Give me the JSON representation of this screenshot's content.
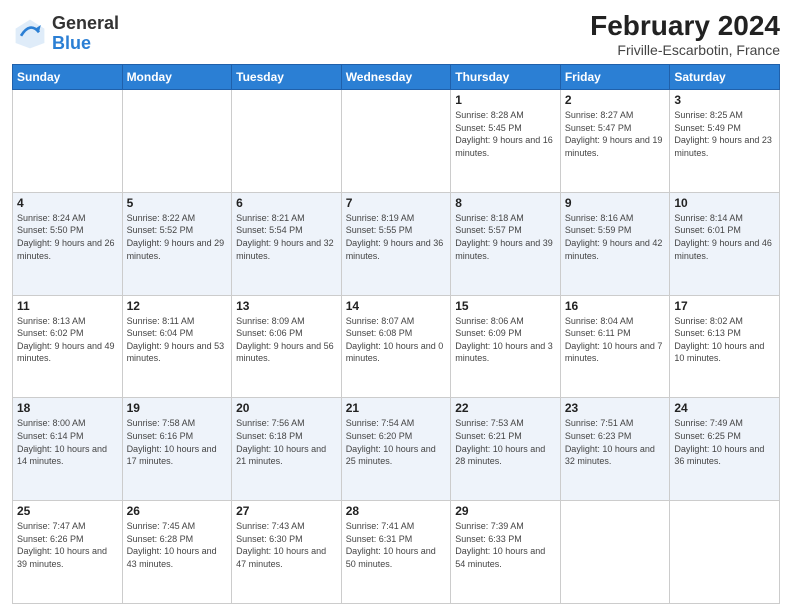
{
  "logo": {
    "general": "General",
    "blue": "Blue"
  },
  "title": "February 2024",
  "subtitle": "Friville-Escarbotin, France",
  "weekdays": [
    "Sunday",
    "Monday",
    "Tuesday",
    "Wednesday",
    "Thursday",
    "Friday",
    "Saturday"
  ],
  "weeks": [
    [
      {
        "day": "",
        "info": ""
      },
      {
        "day": "",
        "info": ""
      },
      {
        "day": "",
        "info": ""
      },
      {
        "day": "",
        "info": ""
      },
      {
        "day": "1",
        "info": "Sunrise: 8:28 AM\nSunset: 5:45 PM\nDaylight: 9 hours and 16 minutes."
      },
      {
        "day": "2",
        "info": "Sunrise: 8:27 AM\nSunset: 5:47 PM\nDaylight: 9 hours and 19 minutes."
      },
      {
        "day": "3",
        "info": "Sunrise: 8:25 AM\nSunset: 5:49 PM\nDaylight: 9 hours and 23 minutes."
      }
    ],
    [
      {
        "day": "4",
        "info": "Sunrise: 8:24 AM\nSunset: 5:50 PM\nDaylight: 9 hours and 26 minutes."
      },
      {
        "day": "5",
        "info": "Sunrise: 8:22 AM\nSunset: 5:52 PM\nDaylight: 9 hours and 29 minutes."
      },
      {
        "day": "6",
        "info": "Sunrise: 8:21 AM\nSunset: 5:54 PM\nDaylight: 9 hours and 32 minutes."
      },
      {
        "day": "7",
        "info": "Sunrise: 8:19 AM\nSunset: 5:55 PM\nDaylight: 9 hours and 36 minutes."
      },
      {
        "day": "8",
        "info": "Sunrise: 8:18 AM\nSunset: 5:57 PM\nDaylight: 9 hours and 39 minutes."
      },
      {
        "day": "9",
        "info": "Sunrise: 8:16 AM\nSunset: 5:59 PM\nDaylight: 9 hours and 42 minutes."
      },
      {
        "day": "10",
        "info": "Sunrise: 8:14 AM\nSunset: 6:01 PM\nDaylight: 9 hours and 46 minutes."
      }
    ],
    [
      {
        "day": "11",
        "info": "Sunrise: 8:13 AM\nSunset: 6:02 PM\nDaylight: 9 hours and 49 minutes."
      },
      {
        "day": "12",
        "info": "Sunrise: 8:11 AM\nSunset: 6:04 PM\nDaylight: 9 hours and 53 minutes."
      },
      {
        "day": "13",
        "info": "Sunrise: 8:09 AM\nSunset: 6:06 PM\nDaylight: 9 hours and 56 minutes."
      },
      {
        "day": "14",
        "info": "Sunrise: 8:07 AM\nSunset: 6:08 PM\nDaylight: 10 hours and 0 minutes."
      },
      {
        "day": "15",
        "info": "Sunrise: 8:06 AM\nSunset: 6:09 PM\nDaylight: 10 hours and 3 minutes."
      },
      {
        "day": "16",
        "info": "Sunrise: 8:04 AM\nSunset: 6:11 PM\nDaylight: 10 hours and 7 minutes."
      },
      {
        "day": "17",
        "info": "Sunrise: 8:02 AM\nSunset: 6:13 PM\nDaylight: 10 hours and 10 minutes."
      }
    ],
    [
      {
        "day": "18",
        "info": "Sunrise: 8:00 AM\nSunset: 6:14 PM\nDaylight: 10 hours and 14 minutes."
      },
      {
        "day": "19",
        "info": "Sunrise: 7:58 AM\nSunset: 6:16 PM\nDaylight: 10 hours and 17 minutes."
      },
      {
        "day": "20",
        "info": "Sunrise: 7:56 AM\nSunset: 6:18 PM\nDaylight: 10 hours and 21 minutes."
      },
      {
        "day": "21",
        "info": "Sunrise: 7:54 AM\nSunset: 6:20 PM\nDaylight: 10 hours and 25 minutes."
      },
      {
        "day": "22",
        "info": "Sunrise: 7:53 AM\nSunset: 6:21 PM\nDaylight: 10 hours and 28 minutes."
      },
      {
        "day": "23",
        "info": "Sunrise: 7:51 AM\nSunset: 6:23 PM\nDaylight: 10 hours and 32 minutes."
      },
      {
        "day": "24",
        "info": "Sunrise: 7:49 AM\nSunset: 6:25 PM\nDaylight: 10 hours and 36 minutes."
      }
    ],
    [
      {
        "day": "25",
        "info": "Sunrise: 7:47 AM\nSunset: 6:26 PM\nDaylight: 10 hours and 39 minutes."
      },
      {
        "day": "26",
        "info": "Sunrise: 7:45 AM\nSunset: 6:28 PM\nDaylight: 10 hours and 43 minutes."
      },
      {
        "day": "27",
        "info": "Sunrise: 7:43 AM\nSunset: 6:30 PM\nDaylight: 10 hours and 47 minutes."
      },
      {
        "day": "28",
        "info": "Sunrise: 7:41 AM\nSunset: 6:31 PM\nDaylight: 10 hours and 50 minutes."
      },
      {
        "day": "29",
        "info": "Sunrise: 7:39 AM\nSunset: 6:33 PM\nDaylight: 10 hours and 54 minutes."
      },
      {
        "day": "",
        "info": ""
      },
      {
        "day": "",
        "info": ""
      }
    ]
  ]
}
